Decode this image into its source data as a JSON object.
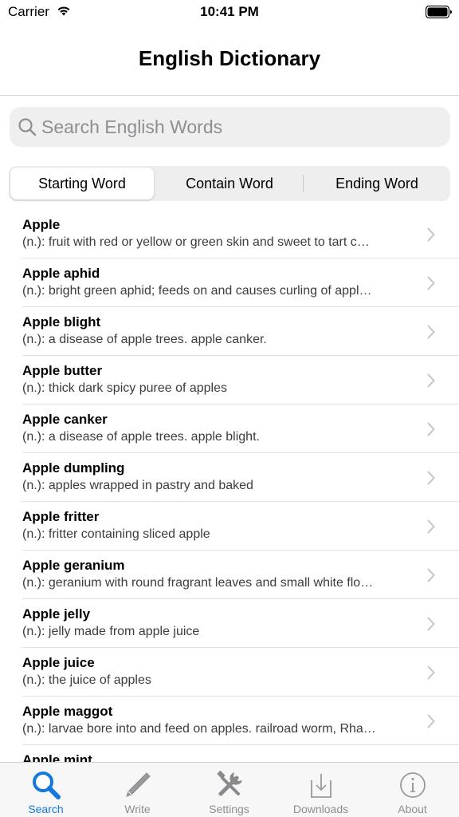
{
  "status_bar": {
    "carrier": "Carrier",
    "time": "10:41 PM"
  },
  "nav": {
    "title": "English Dictionary"
  },
  "search": {
    "placeholder": "Search English Words",
    "value": ""
  },
  "segments": [
    "Starting Word",
    "Contain Word",
    "Ending Word"
  ],
  "selected_segment": "Starting Word",
  "words": [
    {
      "word": "Apple",
      "definition": "(n.): fruit with red or yellow or green skin and sweet to tart c…"
    },
    {
      "word": "Apple aphid",
      "definition": "(n.): bright green aphid; feeds on and causes curling of appl…"
    },
    {
      "word": "Apple blight",
      "definition": "(n.): a disease of apple trees.  apple canker."
    },
    {
      "word": "Apple butter",
      "definition": "(n.): thick dark spicy puree of apples"
    },
    {
      "word": "Apple canker",
      "definition": "(n.): a disease of apple trees.  apple blight."
    },
    {
      "word": "Apple dumpling",
      "definition": "(n.): apples wrapped in pastry and baked"
    },
    {
      "word": "Apple fritter",
      "definition": "(n.): fritter containing sliced apple"
    },
    {
      "word": "Apple geranium",
      "definition": "(n.): geranium with round fragrant leaves and small white flo…"
    },
    {
      "word": "Apple jelly",
      "definition": "(n.): jelly made from apple juice"
    },
    {
      "word": "Apple juice",
      "definition": "(n.): the juice of apples"
    },
    {
      "word": "Apple maggot",
      "definition": "(n.): larvae bore into and feed on apples.  railroad worm, Rha…"
    },
    {
      "word": "Apple mint",
      "definition": ""
    }
  ],
  "tabs": [
    {
      "label": "Search",
      "icon": "magnifier-icon",
      "active": true
    },
    {
      "label": "Write",
      "icon": "pen-icon",
      "active": false
    },
    {
      "label": "Settings",
      "icon": "tools-icon",
      "active": false
    },
    {
      "label": "Downloads",
      "icon": "download-tray-icon",
      "active": false
    },
    {
      "label": "About",
      "icon": "info-icon",
      "active": false
    }
  ],
  "colors": {
    "accent": "#1479dc",
    "inactive": "#8e8e93",
    "search_bg": "#efeff0"
  }
}
